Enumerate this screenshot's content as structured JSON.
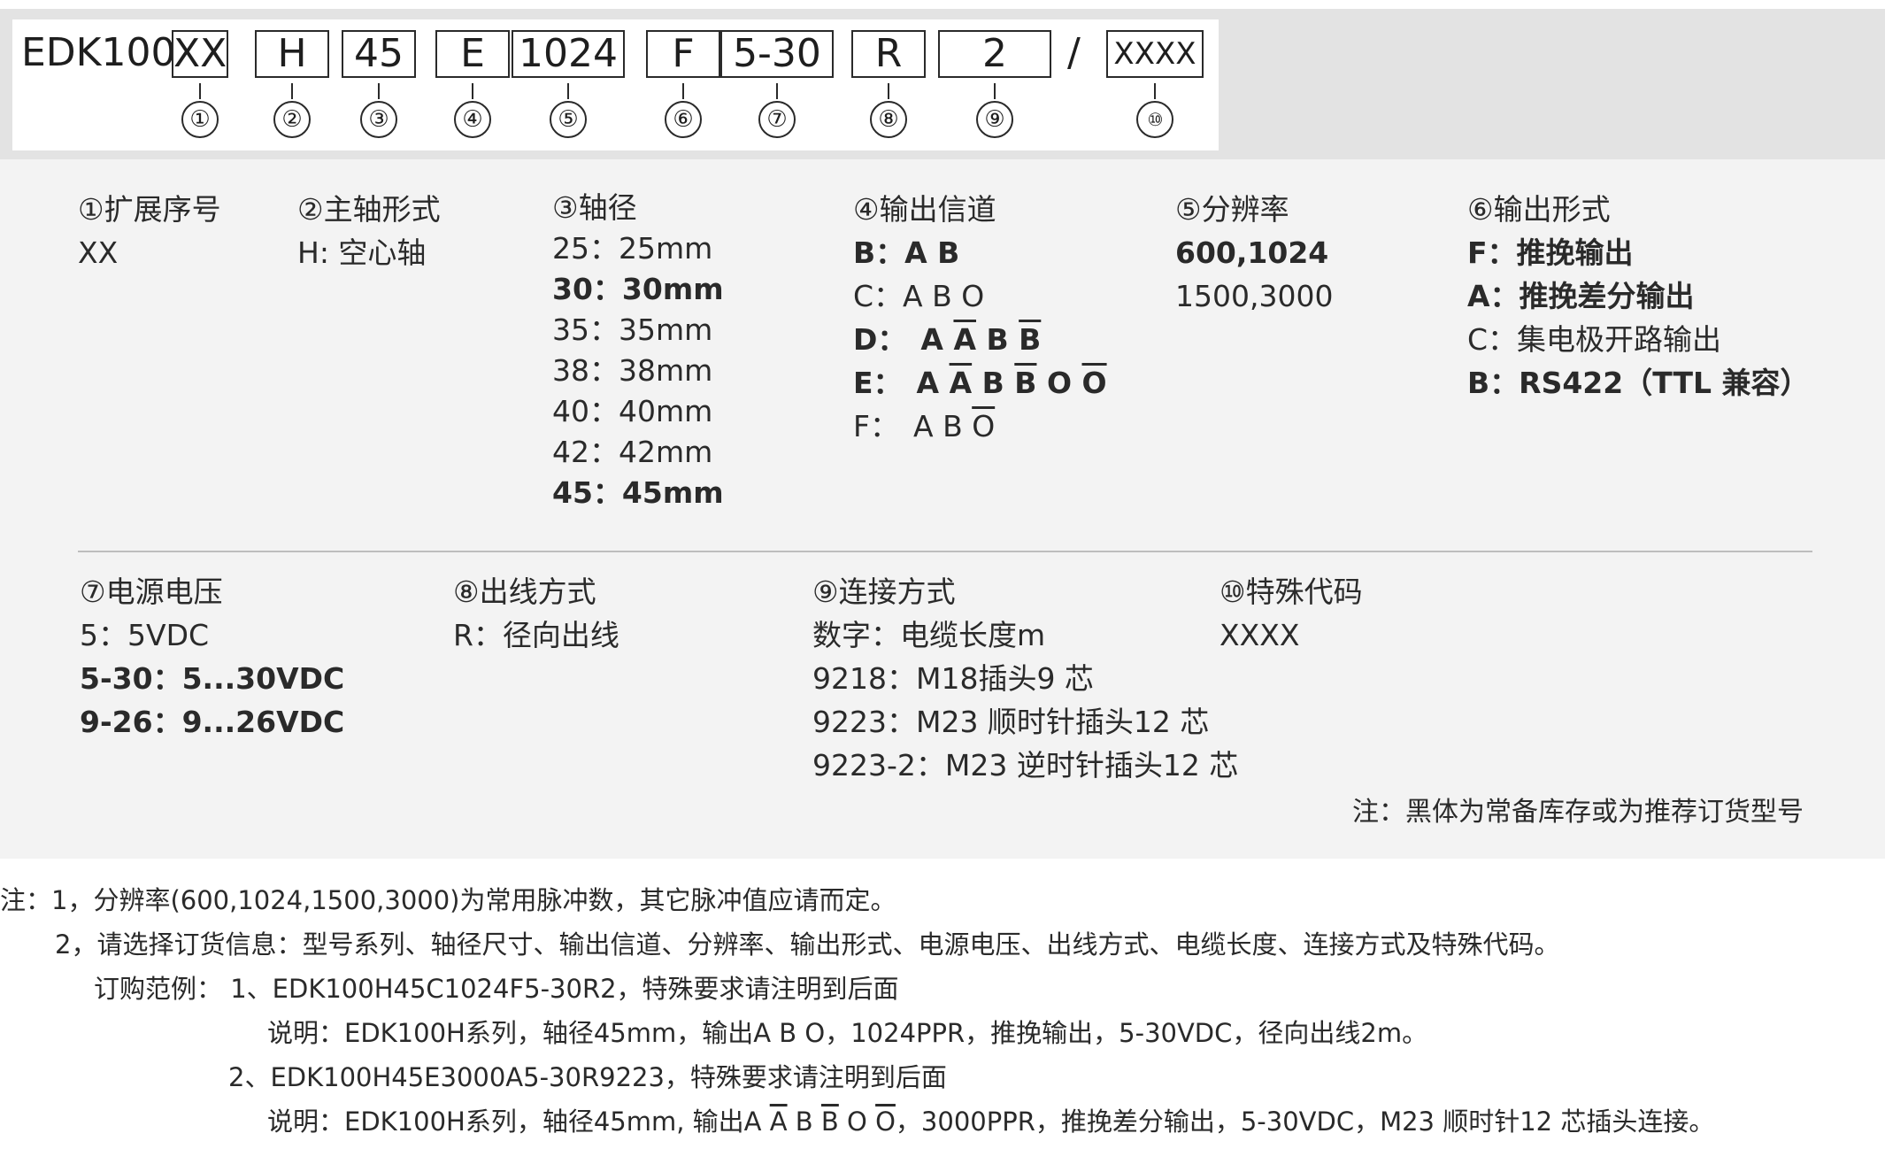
{
  "code": {
    "prefix": "EDK100",
    "segments": [
      "XX",
      "H",
      "45",
      "E",
      "1024",
      "F",
      "5-30",
      "R",
      "2",
      "XXXX"
    ],
    "separator": "/",
    "numbers": [
      "①",
      "②",
      "③",
      "④",
      "⑤",
      "⑥",
      "⑦",
      "⑧",
      "⑨",
      "⑩"
    ]
  },
  "sections": {
    "s1": {
      "title": "①扩展序号",
      "lines": [
        "XX"
      ]
    },
    "s2": {
      "title": "②主轴形式",
      "lines": [
        "H: 空心轴"
      ]
    },
    "s3": {
      "title": "③轴径",
      "lines": [
        "25：25mm",
        "30：30mm",
        "35：35mm",
        "38：38mm",
        "40：40mm",
        "42：42mm",
        "45：45mm"
      ]
    },
    "s4": {
      "title": "④输出信道",
      "lines": [
        "B：A B",
        "C：A B O",
        "D：",
        "E：",
        "F："
      ],
      "letters": [
        "A",
        "A",
        "B",
        "B",
        "O",
        "O"
      ]
    },
    "s5": {
      "title": "⑤分辨率",
      "lines": [
        "600,1024",
        "1500,3000"
      ]
    },
    "s6": {
      "title": "⑥输出形式",
      "lines": [
        "F：推挽输出",
        "A：推挽差分输出",
        "C：集电极开路输出",
        "B：RS422（TTL 兼容）"
      ]
    },
    "s7": {
      "title": "⑦电源电压",
      "lines": [
        "5：5VDC",
        "5-30：5...30VDC",
        "9-26：9...26VDC"
      ]
    },
    "s8": {
      "title": "⑧出线方式",
      "lines": [
        "R：径向出线"
      ]
    },
    "s9": {
      "title": "⑨连接方式",
      "lines": [
        "数字：电缆长度m",
        "9218：M18插头9 芯",
        "9223：M23 顺时针插头12 芯",
        "9223-2：M23 逆时针插头12 芯"
      ]
    },
    "s10": {
      "title": "⑩特殊代码",
      "lines": [
        "XXXX"
      ]
    }
  },
  "panel_note": "注：黑体为常备库存或为推荐订货型号",
  "notes": {
    "n1": "注：1，分辨率(600,1024,1500,3000)为常用脉冲数，其它脉冲值应请而定。",
    "n2": "2，请选择订货信息：型号系列、轴径尺寸、输出信道、分辨率、输出形式、电源电压、出线方式、电缆长度、连接方式及特殊代码。",
    "n3": "订购范例： 1、EDK100H45C1024F5-30R2，特殊要求请注明到后面",
    "n4": "说明：EDK100H系列，轴径45mm，输出A B O，1024PPR，推挽输出，5-30VDC，径向出线2m。",
    "n5": "2、EDK100H45E3000A5-30R9223，特殊要求请注明到后面",
    "n6_a": "说明：EDK100H系列，轴径45mm, 输出A",
    "n6_b": "，3000PPR，推挽差分输出，5-30VDC，M23 顺时针12 芯插头连接。"
  }
}
